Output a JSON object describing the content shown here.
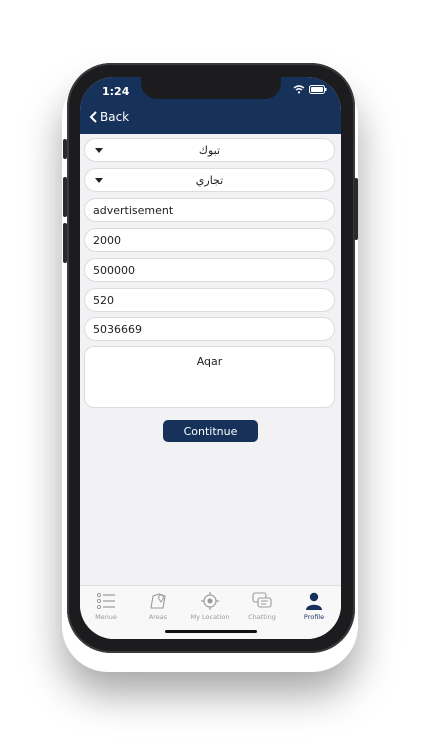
{
  "status": {
    "time": "1:24"
  },
  "nav": {
    "back_label": "Back"
  },
  "form": {
    "city": "تبوك",
    "type": "تجاري",
    "title": "advertisement",
    "area": "2000",
    "price": "500000",
    "number": "520",
    "phone": "5036669",
    "description": "Aqar",
    "continue_label": "Contitnue"
  },
  "tabs": [
    {
      "label": "Menue",
      "icon": "list-icon"
    },
    {
      "label": "Areas",
      "icon": "map-icon"
    },
    {
      "label": "My Location",
      "icon": "location-target-icon"
    },
    {
      "label": "Chatting",
      "icon": "chat-icon"
    },
    {
      "label": "Profile",
      "icon": "person-icon",
      "active": true
    }
  ],
  "colors": {
    "accent": "#17325a",
    "tab_inactive": "#9a9a9a"
  }
}
